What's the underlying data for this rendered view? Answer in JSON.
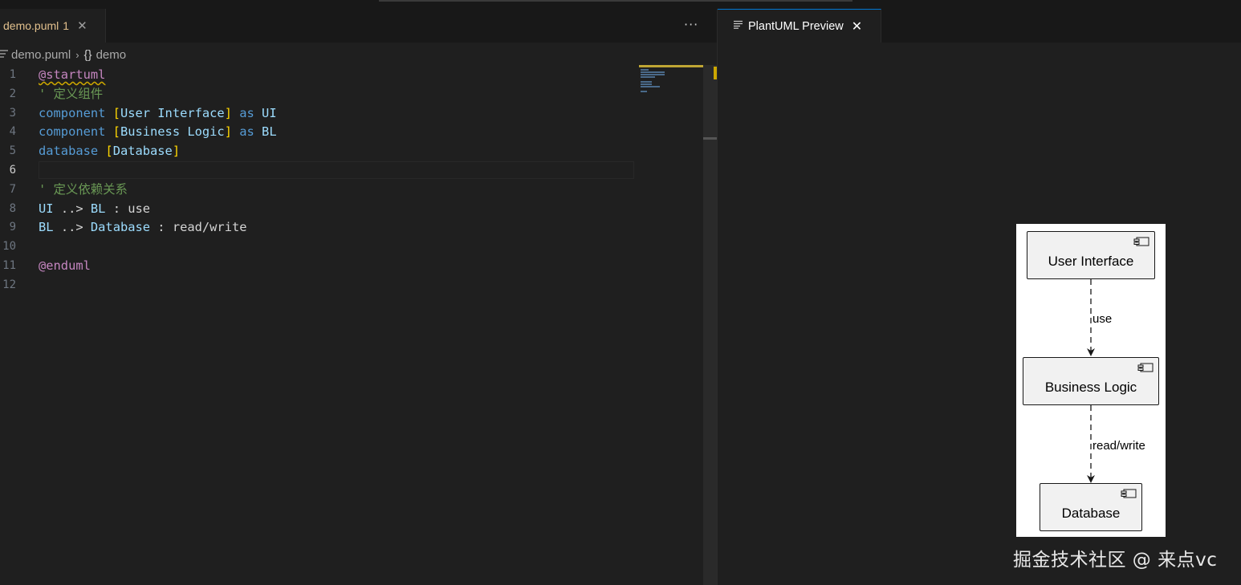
{
  "editor": {
    "tab": {
      "filename": "demo.puml",
      "problems": "1",
      "close": "✕"
    },
    "more_actions": "···",
    "breadcrumb": {
      "file": "demo.puml",
      "separator": "›",
      "symbol_icon": "{}",
      "symbol": "demo"
    },
    "current_line": 6,
    "lines": [
      {
        "n": "1",
        "tokens": [
          {
            "t": "@startuml",
            "c": "k-dec squiggle"
          }
        ]
      },
      {
        "n": "2",
        "tokens": [
          {
            "t": "' 定义组件",
            "c": "k-com"
          }
        ]
      },
      {
        "n": "3",
        "tokens": [
          {
            "t": "component ",
            "c": "k-kw"
          },
          {
            "t": "[",
            "c": "k-br"
          },
          {
            "t": "User Interface",
            "c": "k-id"
          },
          {
            "t": "]",
            "c": "k-br"
          },
          {
            "t": " as ",
            "c": "k-kw"
          },
          {
            "t": "UI",
            "c": "k-id"
          }
        ]
      },
      {
        "n": "4",
        "tokens": [
          {
            "t": "component ",
            "c": "k-kw"
          },
          {
            "t": "[",
            "c": "k-br"
          },
          {
            "t": "Business Logic",
            "c": "k-id"
          },
          {
            "t": "]",
            "c": "k-br"
          },
          {
            "t": " as ",
            "c": "k-kw"
          },
          {
            "t": "BL",
            "c": "k-id"
          }
        ]
      },
      {
        "n": "5",
        "tokens": [
          {
            "t": "database ",
            "c": "k-kw"
          },
          {
            "t": "[",
            "c": "k-br"
          },
          {
            "t": "Database",
            "c": "k-id"
          },
          {
            "t": "]",
            "c": "k-br"
          }
        ]
      },
      {
        "n": "6",
        "tokens": []
      },
      {
        "n": "7",
        "tokens": [
          {
            "t": "' 定义依赖关系",
            "c": "k-com"
          }
        ]
      },
      {
        "n": "8",
        "tokens": [
          {
            "t": "UI",
            "c": "k-id"
          },
          {
            "t": " ..> ",
            "c": "k-def"
          },
          {
            "t": "BL",
            "c": "k-id"
          },
          {
            "t": " : use",
            "c": "k-def"
          }
        ]
      },
      {
        "n": "9",
        "tokens": [
          {
            "t": "BL",
            "c": "k-id"
          },
          {
            "t": " ..> ",
            "c": "k-def"
          },
          {
            "t": "Database",
            "c": "k-id"
          },
          {
            "t": " : read/write",
            "c": "k-def"
          }
        ]
      },
      {
        "n": "10",
        "tokens": []
      },
      {
        "n": "11",
        "tokens": [
          {
            "t": "@enduml",
            "c": "k-dec"
          }
        ]
      },
      {
        "n": "12",
        "tokens": []
      }
    ]
  },
  "preview": {
    "tab": {
      "title": "PlantUML Preview",
      "close": "✕"
    },
    "diagram": {
      "components": [
        {
          "label": "User Interface"
        },
        {
          "label": "Business Logic"
        },
        {
          "label": "Database"
        }
      ],
      "relations": [
        {
          "label": "use"
        },
        {
          "label": "read/write"
        }
      ]
    }
  },
  "watermark": "掘金技术社区 @ 来点vc"
}
